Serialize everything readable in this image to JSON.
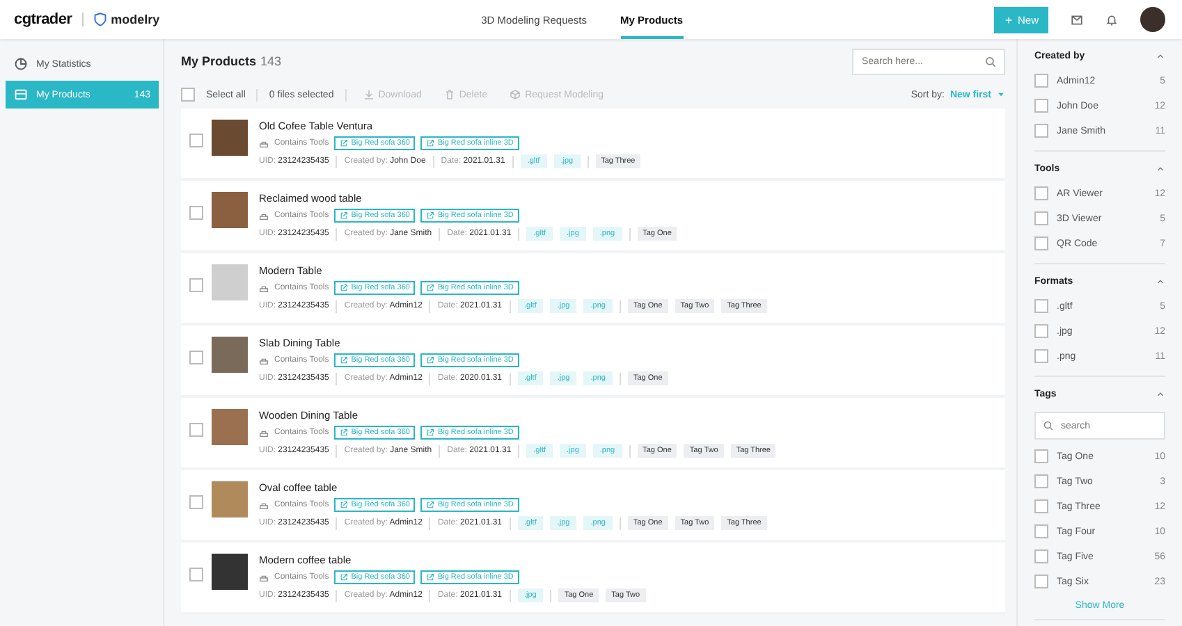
{
  "header": {
    "brand": "cgtrader",
    "product": "modelry",
    "tabs": [
      {
        "label": "3D Modeling Requests",
        "selected": false
      },
      {
        "label": "My Products",
        "selected": true
      }
    ],
    "new_button": "New"
  },
  "sidebar": {
    "items": [
      {
        "label": "My Statistics",
        "selected": false
      },
      {
        "label": "My Products",
        "count": "143",
        "selected": true
      }
    ]
  },
  "main": {
    "title": "My Products",
    "count": "143",
    "search": {
      "placeholder": "Search here..."
    },
    "toolbar": {
      "select_all": "Select all",
      "select_all_checked": false,
      "selected_info": "0 files selected",
      "actions": [
        {
          "label": "Download",
          "disabled": true
        },
        {
          "label": "Delete",
          "disabled": true
        },
        {
          "label": "Request Modeling",
          "disabled": true
        }
      ],
      "sort_label": "Sort by:",
      "sort_value": "New first"
    },
    "products": [
      {
        "title": "Old Cofee Table Ventura",
        "checked": false,
        "tools_label": "Contains Tools",
        "links": [
          "Big Red sofa 360",
          "Big Red sofa inline 3D"
        ],
        "uid_label": "UID:",
        "uid": "23124235435",
        "created_label": "Created by:",
        "created_by": "John Doe",
        "date_label": "Date:",
        "date": "2021.01.31",
        "formats": [
          ".gltf",
          ".jpg"
        ],
        "tags": [
          "Tag Three"
        ]
      },
      {
        "title": "Reclaimed wood table",
        "checked": false,
        "tools_label": "Contains Tools",
        "links": [
          "Big Red sofa 360",
          "Big Red sofa inline 3D"
        ],
        "uid_label": "UID:",
        "uid": "23124235435",
        "created_label": "Created by:",
        "created_by": "Jane Smith",
        "date_label": "Date:",
        "date": "2021.01.31",
        "formats": [
          ".gltf",
          ".jpg",
          ".png"
        ],
        "tags": [
          "Tag One"
        ]
      },
      {
        "title": "Modern Table",
        "checked": false,
        "tools_label": "Contains Tools",
        "links": [
          "Big Red sofa 360",
          "Big Red sofa inline 3D"
        ],
        "uid_label": "UID:",
        "uid": "23124235435",
        "created_label": "Created by:",
        "created_by": "Admin12",
        "date_label": "Date:",
        "date": "2021.01.31",
        "formats": [
          ".gltf",
          ".jpg",
          ".png"
        ],
        "tags": [
          "Tag One",
          "Tag Two",
          "Tag Three"
        ]
      },
      {
        "title": "Slab Dining Table",
        "checked": false,
        "tools_label": "Contains Tools",
        "links": [
          "Big Red sofa 360",
          "Big Red sofa inline 3D"
        ],
        "uid_label": "UID:",
        "uid": "23124235435",
        "created_label": "Created by:",
        "created_by": "Admin12",
        "date_label": "Date:",
        "date": "2020.01.31",
        "formats": [
          ".gltf",
          ".jpg",
          ".png"
        ],
        "tags": [
          "Tag One"
        ]
      },
      {
        "title": "Wooden Dining Table",
        "checked": false,
        "tools_label": "Contains Tools",
        "links": [
          "Big Red sofa 360",
          "Big Red sofa inline 3D"
        ],
        "uid_label": "UID:",
        "uid": "23124235435",
        "created_label": "Created by:",
        "created_by": "Jane Smith",
        "date_label": "Date:",
        "date": "2021.01.31",
        "formats": [
          ".gltf",
          ".jpg",
          ".png"
        ],
        "tags": [
          "Tag One",
          "Tag Two",
          "Tag Three"
        ]
      },
      {
        "title": "Oval coffee table",
        "checked": false,
        "tools_label": "Contains Tools",
        "links": [
          "Big Red sofa 360",
          "Big Red sofa inline 3D"
        ],
        "uid_label": "UID:",
        "uid": "23124235435",
        "created_label": "Created by:",
        "created_by": "Admin12",
        "date_label": "Date:",
        "date": "2021.01.31",
        "formats": [
          ".gltf",
          ".jpg",
          ".png"
        ],
        "tags": [
          "Tag One",
          "Tag Two",
          "Tag Three"
        ]
      },
      {
        "title": "Modern coffee table",
        "checked": false,
        "tools_label": "Contains Tools",
        "links": [
          "Big Red sofa 360",
          "Big Red sofa inline 3D"
        ],
        "uid_label": "UID:",
        "uid": "23124235435",
        "created_label": "Created by:",
        "created_by": "Admin12",
        "date_label": "Date:",
        "date": "2021.01.31",
        "formats": [
          ".jpg"
        ],
        "tags": [
          "Tag One",
          "Tag Two"
        ]
      }
    ]
  },
  "filters": {
    "sections": [
      {
        "title": "Created by",
        "expanded": true,
        "options": [
          {
            "label": "Admin12",
            "count": "5",
            "checked": false
          },
          {
            "label": "John Doe",
            "count": "12",
            "checked": false
          },
          {
            "label": "Jane Smith",
            "count": "11",
            "checked": false
          }
        ]
      },
      {
        "title": "Tools",
        "expanded": true,
        "options": [
          {
            "label": "AR Viewer",
            "count": "12",
            "checked": false
          },
          {
            "label": "3D Viewer",
            "count": "5",
            "checked": false
          },
          {
            "label": "QR Code",
            "count": "7",
            "checked": false
          }
        ]
      },
      {
        "title": "Formats",
        "expanded": true,
        "options": [
          {
            "label": ".gltf",
            "count": "5",
            "checked": false
          },
          {
            "label": ".jpg",
            "count": "12",
            "checked": false
          },
          {
            "label": ".png",
            "count": "11",
            "checked": false
          }
        ]
      },
      {
        "title": "Tags",
        "expanded": true,
        "search_placeholder": "search",
        "options": [
          {
            "label": "Tag One",
            "count": "10",
            "checked": false
          },
          {
            "label": "Tag Two",
            "count": "3",
            "checked": false
          },
          {
            "label": "Tag Three",
            "count": "12",
            "checked": false
          },
          {
            "label": "Tag Four",
            "count": "10",
            "checked": false
          },
          {
            "label": "Tag Five",
            "count": "56",
            "checked": false
          },
          {
            "label": "Tag Six",
            "count": "23",
            "checked": false
          }
        ],
        "more": "Show More"
      }
    ]
  }
}
